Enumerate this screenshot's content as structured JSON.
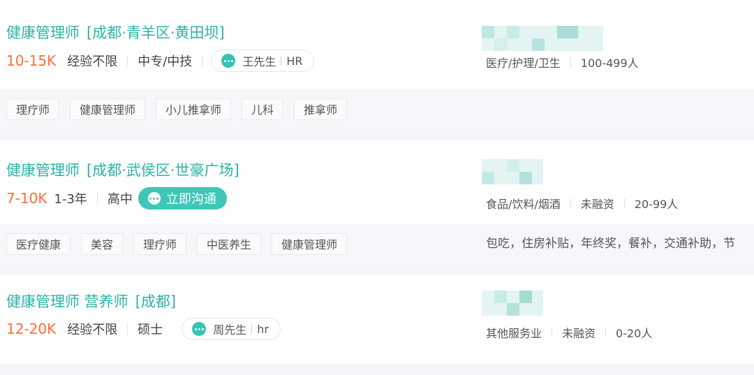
{
  "jobs": [
    {
      "title": "健康管理师",
      "location": "[成都·青羊区·黄田坝]",
      "salary": "10-15K",
      "experience": "经验不限",
      "education": "中专/中技",
      "contact": {
        "name": "王先生",
        "role": "HR",
        "icon": "chat-bubble-icon"
      },
      "company": {
        "industry": "医疗/护理/卫生",
        "size": "100-499人"
      },
      "tags": [
        "理疗师",
        "健康管理师",
        "小儿推拿师",
        "儿科",
        "推拿师"
      ]
    },
    {
      "title": "健康管理师",
      "location": "[成都·武侯区·世豪广场]",
      "salary": "7-10K",
      "experience": "1-3年",
      "education": "高中",
      "chat_button": "立即沟通",
      "company": {
        "industry": "食品/饮料/烟酒",
        "funding": "未融资",
        "size": "20-99人"
      },
      "tags": [
        "医疗健康",
        "美容",
        "理疗师",
        "中医养生",
        "健康管理师"
      ],
      "benefits": "包吃，住房补贴，年终奖，餐补，交通补助，节"
    },
    {
      "title": "健康管理师 营养师",
      "location": "[成都]",
      "salary": "12-20K",
      "experience": "经验不限",
      "education": "硕士",
      "contact": {
        "name": "周先生",
        "role": "hr",
        "icon": "chat-bubble-icon"
      },
      "company": {
        "industry": "其他服务业",
        "funding": "未融资",
        "size": "0-20人"
      }
    }
  ],
  "colors": {
    "accent": "#2bb3a6",
    "salary": "#fe6d38",
    "button": "#3fc6b7"
  }
}
